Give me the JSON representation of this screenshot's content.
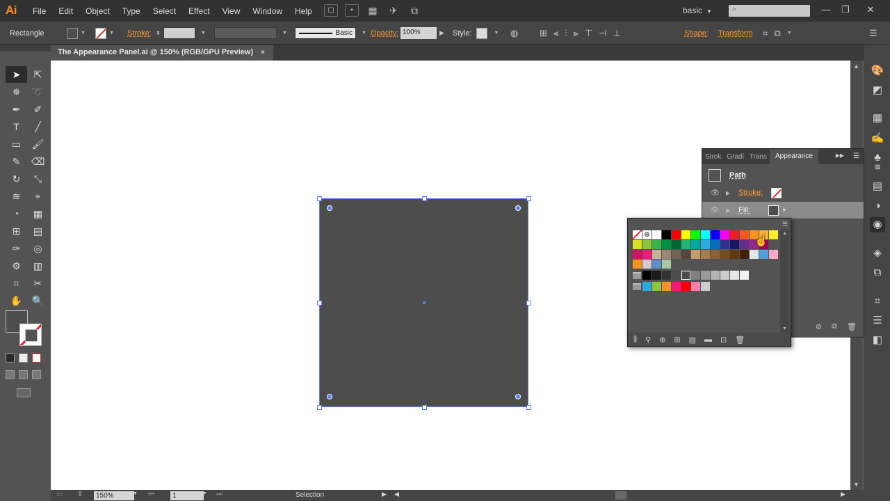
{
  "app": {
    "logo": "Ai"
  },
  "menu": [
    "File",
    "Edit",
    "Object",
    "Type",
    "Select",
    "Effect",
    "View",
    "Window",
    "Help"
  ],
  "workspace": "basic",
  "control": {
    "selection_type": "Rectangle",
    "stroke_label": "Stroke:",
    "brush_label": "Basic",
    "opacity_label": "Opacity:",
    "opacity_value": "100%",
    "style_label": "Style:",
    "shape_label": "Shape:",
    "transform_label": "Transform"
  },
  "document": {
    "tab_title": "The Appearance Panel.ai @ 150% (RGB/GPU Preview)",
    "close": "×"
  },
  "status": {
    "zoom": "150%",
    "page": "1",
    "tool": "Selection"
  },
  "appearance": {
    "tabs": [
      "Strok",
      "Gradi",
      "Trans",
      "Appearance"
    ],
    "object_label": "Path",
    "stroke_label": "Stroke:",
    "fill_label": "Fill:"
  },
  "colors": {
    "ui_dark": "#323232",
    "ui_mid": "#535353",
    "accent_orange": "#ff9a2e",
    "selection_blue": "#5b7ef0",
    "artwork_fill": "#4d4d4d"
  },
  "swatches": {
    "row1": [
      "#ffffff",
      "#000000",
      "#ff0000",
      "#ffff00",
      "#00ff00",
      "#00ffff",
      "#0000ff",
      "#ff00ff",
      "#ec1c24",
      "#f15a24",
      "#f7931e",
      "#fbb03b",
      "#fcee21"
    ],
    "row2": [
      "#d9e021",
      "#8cc63f",
      "#39b54a",
      "#009245",
      "#006837",
      "#22b573",
      "#00a99d",
      "#29abe2",
      "#0071bc",
      "#2e3192",
      "#1b1464",
      "#662d91",
      "#93278f",
      "#9e005d"
    ],
    "row3": [
      "#d4145a",
      "#ed1e79",
      "#c7b299",
      "#998675",
      "#736357",
      "#534741",
      "#c69c6d",
      "#a67c52",
      "#8c6239",
      "#754c24",
      "#603813",
      "#42210b",
      "#e6e6e6",
      "#4d9fe0",
      "#f9a8c8"
    ],
    "row4": [
      "#f7931e",
      "#cfcfcf",
      "#5a8fc9",
      "#a6c7a0"
    ],
    "grays": [
      "#000000",
      "#1a1a1a",
      "#333333",
      "#4d4d4d",
      "#666666",
      "#808080",
      "#999999",
      "#b3b3b3",
      "#cccccc",
      "#e6e6e6",
      "#f2f2f2"
    ],
    "brights": [
      "#29abe2",
      "#8cc63f",
      "#f7931e",
      "#ed1e79",
      "#ff0000",
      "#ff7bac",
      "#cccccc"
    ]
  }
}
